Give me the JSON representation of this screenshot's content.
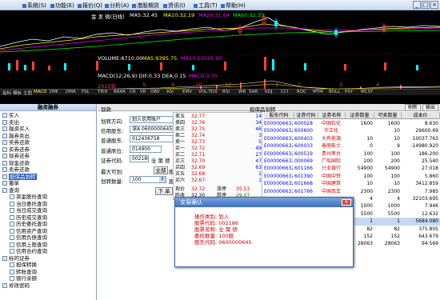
{
  "menu": {
    "items": [
      "系统(S)",
      "功能(E)",
      "报价(Q)",
      "分析(A)",
      "港股期货",
      "资讯(I)",
      "工具(T)",
      "帮助(H)"
    ]
  },
  "chart": {
    "title": "金 发 微(日线)",
    "ma5": "MA5:32.45",
    "ma10": "MA10:32.19",
    "ma20": "MA20:31.64",
    "ma60": "MA60:32.35",
    "volume_line": "VOLUME:6710.00",
    "vol_ma5": "MA5:9395.75",
    "vol_ma10": "MA10:10595.90",
    "macd_line": "MACD(12,26,9) DIF:0.33 DEA:0.15",
    "macd_val": "MACD:0.35",
    "year_label": "2010年",
    "tick_a": "5",
    "tick_b": "9",
    "tick_c": "10",
    "tick_d": "12",
    "tick_e": "1",
    "tick_f": "2",
    "tick_g": "3",
    "tick_h": "4",
    "indicator_tabs": [
      "指标",
      "模板",
      "主图",
      "MACD",
      "DMI",
      "DMA",
      "FSL",
      "TRIX",
      "BRAR",
      "CR",
      "VR",
      "OBV",
      "ASI",
      "EMV",
      "VOL-TDX",
      "RSI",
      "WR",
      "SAR",
      "KDJ",
      "CCI",
      "ROC",
      "MTM",
      "BOLL",
      "PSY",
      "MCST"
    ]
  },
  "left": {
    "title": "融资融券",
    "items": [
      "买入",
      "卖出",
      "融资买入",
      "融券卖出",
      "卖券还款",
      "买券还券",
      "现券还券",
      "现金还款",
      "卖券还款",
      "担保品划转",
      "撤单",
      "查询",
      "资金股份查询",
      "当日委托查询",
      "当日成交查询",
      "历史成交查询",
      "历史委托查询",
      "信用资产查询",
      "信用负债查询",
      "信用上限查询",
      "信用合约查询",
      "标的证券",
      "担保转换",
      "转账查询",
      "银行余额",
      "修改密码"
    ]
  },
  "main": {
    "tab": "划款",
    "header": "担保品划转",
    "refresh": "刷新",
    "output": "输出",
    "labels": {
      "direction": "划转方向:",
      "credit_account": "信用股东:",
      "normal_account": "普通股东:",
      "normal_seat": "普通席位:",
      "stock_code": "证券代码:",
      "max_qty": "最大可划:",
      "qty": "划转数量:"
    },
    "values": {
      "direction": "划入信用账户",
      "credit_account": "深A 0600000645",
      "normal_account": "012436758",
      "normal_seat": "014900",
      "stock_code": "002186",
      "stock_name": "全 聚 德",
      "qty": "100",
      "qty_unit": "股"
    },
    "buttons": {
      "all": "全部",
      "submit": "下 单"
    },
    "all_suffix": "股"
  },
  "quote": {
    "rows": [
      {
        "l": "卖五",
        "p": "32.77",
        "v": "14"
      },
      {
        "l": "卖四",
        "p": "32.76",
        "v": "34"
      },
      {
        "l": "卖三",
        "p": "32.75",
        "v": "46"
      },
      {
        "l": "卖二",
        "p": "32.74",
        "v": "3"
      },
      {
        "l": "卖一",
        "p": "32.73",
        "v": "5"
      },
      {
        "l": "买一",
        "p": "32.72",
        "v": "49"
      },
      {
        "l": "买二",
        "p": "32.71",
        "v": "27"
      },
      {
        "l": "买三",
        "p": "32.70",
        "v": "47"
      },
      {
        "l": "买四",
        "p": "32.69",
        "v": "63"
      },
      {
        "l": "买五",
        "p": "32.68",
        "v": "1"
      },
      {
        "l": "买六",
        "p": "32.67",
        "v": "1"
      }
    ],
    "last_label": "现价",
    "last": "32.72",
    "change_label": "涨停",
    "change": "35.53",
    "prev_label": "昨收",
    "prev": "32.30",
    "limit_label": "跌停",
    "limit": "29.07"
  },
  "table": {
    "headers": [
      "股东代码",
      "证券代码",
      "证券名称",
      "证券数量",
      "可卖数量",
      "成本价"
    ],
    "rows": [
      [
        "E000006632",
        "600028",
        "中国石化",
        "1600",
        "1600",
        "8.630"
      ],
      [
        "E000006632",
        "600600",
        "华立化",
        "",
        "10",
        "29600.69"
      ],
      [
        "E000006632",
        "600403",
        "大有能源",
        "10",
        "10",
        "10037.763"
      ],
      [
        "E000006632",
        "600033",
        "泰丽能士",
        "0",
        "9",
        "-14980.920"
      ],
      [
        "E000006632",
        "600519",
        "贵州茅台",
        "100",
        "100",
        "186.200"
      ],
      [
        "E000006632",
        "000069",
        "广船国际",
        "200",
        "200",
        "25.540"
      ],
      [
        "E000006632",
        "601166",
        "兴业银行",
        "54900",
        "54900",
        "27.018"
      ],
      [
        "E000006632",
        "601390",
        "中国中铁",
        "100",
        "100",
        "5.860"
      ],
      [
        "E000006632",
        "601668",
        "中国建筑",
        "10",
        "10",
        "3412.859"
      ],
      [
        "E000006632",
        "601766",
        "中国南车",
        "2300",
        "2300",
        "7.985"
      ],
      [
        "",
        "",
        "",
        "4",
        "4",
        "32103.695"
      ],
      [
        "",
        "",
        "",
        "1000",
        "1000",
        "7.946"
      ],
      [
        "",
        "",
        "",
        "5500",
        "5500",
        "12.632"
      ],
      [
        "",
        "",
        "",
        "1",
        "1",
        "5684.080"
      ],
      [
        "",
        "",
        "",
        "82",
        "82",
        "375.805"
      ],
      [
        "",
        "",
        "",
        "152",
        "152",
        "643.679"
      ],
      [
        "",
        "",
        "",
        "28063",
        "28063",
        "94.569"
      ]
    ]
  },
  "dialog": {
    "title": "交易确认",
    "close": "x",
    "lines": [
      "操作类别: 划入",
      "股票代码: 002186",
      "股票名称: 全 聚 德",
      "委托数量: 100股",
      "股东代码: 0600000645"
    ]
  },
  "colors": {
    "accent": "#2a5fbf",
    "up": "#dd0000",
    "down": "#008800",
    "chart_bg": "#000000"
  }
}
